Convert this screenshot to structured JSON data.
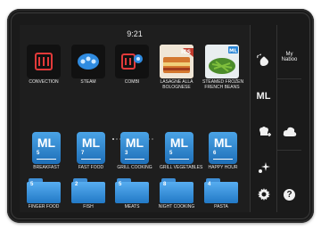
{
  "status": {
    "time": "9:21"
  },
  "row1": [
    {
      "label": "CONVECTION",
      "icon": "convection-icon"
    },
    {
      "label": "STEAM",
      "icon": "steam-icon"
    },
    {
      "label": "COMBI",
      "icon": "combi-icon"
    },
    {
      "label": "LASAGNE ALLA\nBOLOGNESE",
      "badge": "ICS"
    },
    {
      "label": "STEAMED FROZEN\nFRENCH BEANS",
      "badge": "ML"
    }
  ],
  "row2": [
    {
      "count": "5",
      "label": "BREAKFAST"
    },
    {
      "count": "7",
      "label": "FAST FOOD"
    },
    {
      "count": "3",
      "label": "GRILL COOKING"
    },
    {
      "count": "5",
      "label": "GRILL VEGETABLES"
    },
    {
      "count": "6",
      "label": "HAPPY HOUR"
    }
  ],
  "row3": [
    {
      "count": "5",
      "label": "FINGER FOOD"
    },
    {
      "count": "2",
      "label": "FISH"
    },
    {
      "count": "5",
      "label": "MEATS"
    },
    {
      "count": "8",
      "label": "NIGHT COOKING"
    },
    {
      "count": "4",
      "label": "PASTA"
    }
  ],
  "card_text": "ML",
  "sidebar": {
    "logo_line1": "My",
    "logo_line2": "Naboo",
    "ml_label": "ML",
    "help_label": "?"
  },
  "colors": {
    "accent": "#2a86d6",
    "red_icon": "#e23a3a",
    "screen_bg": "#1e1e1e"
  }
}
